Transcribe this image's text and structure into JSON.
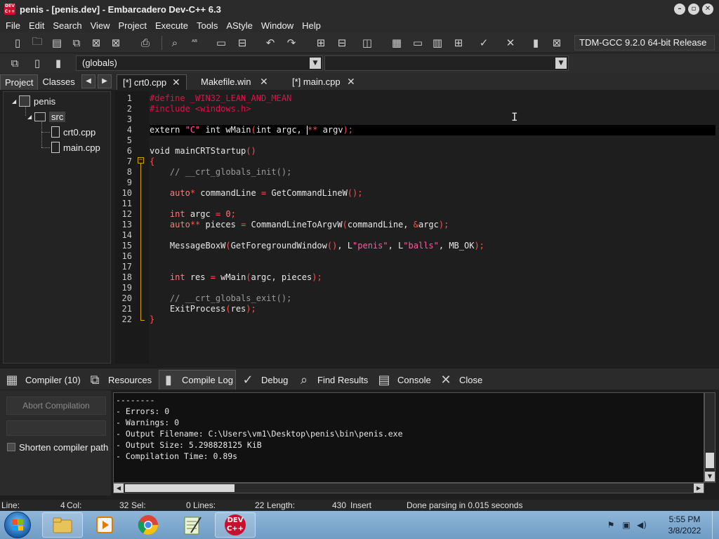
{
  "window": {
    "title": "penis - [penis.dev] - Embarcadero Dev-C++ 6.3",
    "app_icon": "DEV C++"
  },
  "menu": [
    "File",
    "Edit",
    "Search",
    "View",
    "Project",
    "Execute",
    "Tools",
    "AStyle",
    "Window",
    "Help"
  ],
  "toolbar": {
    "compiler": "TDM-GCC 9.2.0 64-bit Release",
    "scope": "(globals)"
  },
  "left_panel": {
    "tabs": [
      "Project",
      "Classes"
    ],
    "tree": {
      "project": "penis",
      "folder": "src",
      "files": [
        "crt0.cpp",
        "main.cpp"
      ]
    }
  },
  "editor_tabs": [
    "[*] crt0.cpp",
    "Makefile.win",
    "[*] main.cpp"
  ],
  "code": {
    "line_numbers": [
      "1",
      "2",
      "3",
      "4",
      "5",
      "6",
      "7",
      "8",
      "9",
      "10",
      "11",
      "12",
      "13",
      "14",
      "15",
      "16",
      "17",
      "18",
      "19",
      "20",
      "21",
      "22"
    ]
  },
  "bottom_tabs": [
    "Compiler (10)",
    "Resources",
    "Compile Log",
    "Debug",
    "Find Results",
    "Console",
    "Close"
  ],
  "compile_panel": {
    "abort_label": "Abort Compilation",
    "shorten_label": "Shorten compiler path",
    "log": [
      "--------",
      "- Errors: 0",
      "- Warnings: 0",
      "- Output Filename: C:\\Users\\vm1\\Desktop\\penis\\bin\\penis.exe",
      "- Output Size: 5.298828125 KiB",
      "- Compilation Time: 0.89s"
    ]
  },
  "status": {
    "line_label": "Line:",
    "line_value": "4",
    "col_label": "Col:",
    "col_value": "32",
    "sel_label": "Sel:",
    "sel_value": "0",
    "lines_label": "Lines:",
    "lines_value": "22",
    "length_label": "Length:",
    "length_value": "430",
    "mode": "Insert",
    "message": "Done parsing in 0.015 seconds"
  },
  "taskbar": {
    "time": "5:55 PM",
    "date": "3/8/2022",
    "devcpp_label": "DEV C++"
  },
  "colors": {
    "preprocessor": "#e0114a",
    "string": "#ff5aa0",
    "comment": "#9a9a9a",
    "fold": "#d7a100",
    "background": "#1e1e1e"
  }
}
